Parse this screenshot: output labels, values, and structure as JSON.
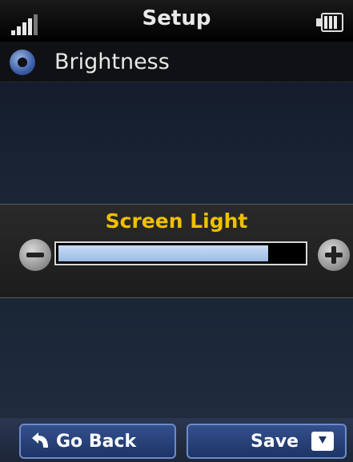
{
  "status": {
    "title": "Setup",
    "signal_icon": "signal-icon",
    "battery_icon": "battery-icon"
  },
  "header": {
    "title": "Brightness",
    "icon": "navigation-icon"
  },
  "panel": {
    "title": "Screen Light",
    "level": 0.86,
    "decrease_icon": "minus-icon",
    "increase_icon": "plus-icon"
  },
  "softkeys": {
    "back_label": "Go Back",
    "save_label": "Save"
  },
  "colors": {
    "accent": "#f0c000",
    "fill": "#9dbbe5",
    "softkey": "#1e3466"
  }
}
